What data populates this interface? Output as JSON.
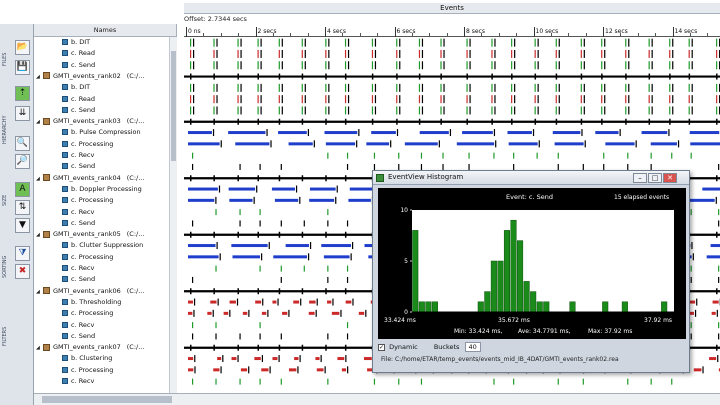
{
  "toolbar": {
    "sections": [
      {
        "label": "FILES"
      },
      {
        "label": "HIERARCHY"
      },
      {
        "label": "SIZE"
      },
      {
        "label": "SORTING"
      },
      {
        "label": "FILTERS"
      }
    ],
    "buttons": [
      {
        "name": "open-folder-icon",
        "glyph": "📂"
      },
      {
        "name": "save-icon",
        "glyph": "💾"
      },
      {
        "name": "hierarchy-up-icon",
        "glyph": "⇡"
      },
      {
        "name": "hierarchy-collapse-icon",
        "glyph": "⇊"
      },
      {
        "name": "zoom-in-icon",
        "glyph": "🔍"
      },
      {
        "name": "zoom-out-icon",
        "glyph": "🔎"
      },
      {
        "name": "sort-asc-icon",
        "glyph": "A"
      },
      {
        "name": "sort-order-icon",
        "glyph": "⇅"
      },
      {
        "name": "sort-dropdown-icon",
        "glyph": "▼"
      },
      {
        "name": "filter-icon",
        "glyph": "⧩"
      },
      {
        "name": "filter-clear-icon",
        "glyph": "✖"
      }
    ]
  },
  "names_panel": {
    "header": "Names",
    "rows": [
      {
        "kind": "task",
        "text": "b. DIT"
      },
      {
        "kind": "task",
        "text": "c. Read"
      },
      {
        "kind": "task",
        "text": "c. Send"
      },
      {
        "kind": "group",
        "text": "GMTI_events_rank02",
        "path": "(C:/..."
      },
      {
        "kind": "task",
        "text": "b. DIT"
      },
      {
        "kind": "task",
        "text": "c. Read"
      },
      {
        "kind": "task",
        "text": "c. Send"
      },
      {
        "kind": "group",
        "text": "GMTI_events_rank03",
        "path": "(C:/..."
      },
      {
        "kind": "task",
        "text": "b. Pulse Compression"
      },
      {
        "kind": "task",
        "text": "c. Processing"
      },
      {
        "kind": "task",
        "text": "c. Recv"
      },
      {
        "kind": "task",
        "text": "c. Send"
      },
      {
        "kind": "group",
        "text": "GMTI_events_rank04",
        "path": "(C:/..."
      },
      {
        "kind": "task",
        "text": "b. Doppler Processing"
      },
      {
        "kind": "task",
        "text": "c. Processing"
      },
      {
        "kind": "task",
        "text": "c. Recv"
      },
      {
        "kind": "task",
        "text": "c. Send"
      },
      {
        "kind": "group",
        "text": "GMTI_events_rank05",
        "path": "(C:/..."
      },
      {
        "kind": "task",
        "text": "b. Clutter Suppression"
      },
      {
        "kind": "task",
        "text": "c. Processing"
      },
      {
        "kind": "task",
        "text": "c. Recv"
      },
      {
        "kind": "task",
        "text": "c. Send"
      },
      {
        "kind": "group",
        "text": "GMTI_events_rank06",
        "path": "(C:/..."
      },
      {
        "kind": "task",
        "text": "b. Thresholding"
      },
      {
        "kind": "task",
        "text": "c. Processing"
      },
      {
        "kind": "task",
        "text": "c. Recv"
      },
      {
        "kind": "task",
        "text": "c. Send"
      },
      {
        "kind": "group",
        "text": "GMTI_events_rank07",
        "path": "(C:/..."
      },
      {
        "kind": "task",
        "text": "b. Clustering"
      },
      {
        "kind": "task",
        "text": "c. Processing"
      },
      {
        "kind": "task",
        "text": "c. Recv"
      }
    ]
  },
  "events": {
    "title": "Events",
    "offset": "Offset: 2.7344 secs",
    "ruler_labels": [
      "0 ns",
      "2 secs",
      "4 secs",
      "6 secs",
      "8 secs",
      "10 secs",
      "12 secs",
      "14 secs"
    ]
  },
  "histogram": {
    "window_title": "EventView Histogram",
    "event_label": "Event: c. Send",
    "elapsed_label": "15 elapsed events",
    "y_ticks": [
      "10",
      "5",
      "0"
    ],
    "x_min_label": "33.424 ms",
    "x_mid_label": "35.672 ms",
    "x_max_label": "37.92 ms",
    "stats": {
      "min": "Min: 33.424 ms,",
      "ave": "Ave: 34.7791 ms,",
      "max": "Max: 37.92 ms"
    },
    "dynamic_label": "Dynamic",
    "dynamic_checked": true,
    "buckets_label": "Buckets",
    "buckets_value": "40",
    "file_path": "File: C:/home/ETAR/temp_events/events_mid_IB_4DAT/GMTI_events_rank02.rea",
    "bar_color": "#1a8a1a",
    "chart_data": {
      "type": "bar",
      "title": "Event: c. Send",
      "xlabel": "",
      "ylabel": "",
      "ylim": [
        0,
        10
      ],
      "xlim": [
        33.424,
        37.92
      ],
      "buckets": 40,
      "values": [
        8,
        1,
        1,
        1,
        0,
        0,
        0,
        0,
        0,
        0,
        1,
        2,
        5,
        5,
        8,
        9,
        7,
        3,
        2,
        1,
        1,
        0,
        0,
        0,
        1,
        0,
        0,
        0,
        0,
        1,
        0,
        0,
        1,
        0,
        0,
        0,
        0,
        0,
        1,
        0
      ]
    }
  },
  "colors": {
    "timeline_black": "#000000",
    "timeline_green": "#1f9a2a",
    "timeline_red": "#cc2a2a",
    "timeline_blue": "#1f3ecc"
  }
}
